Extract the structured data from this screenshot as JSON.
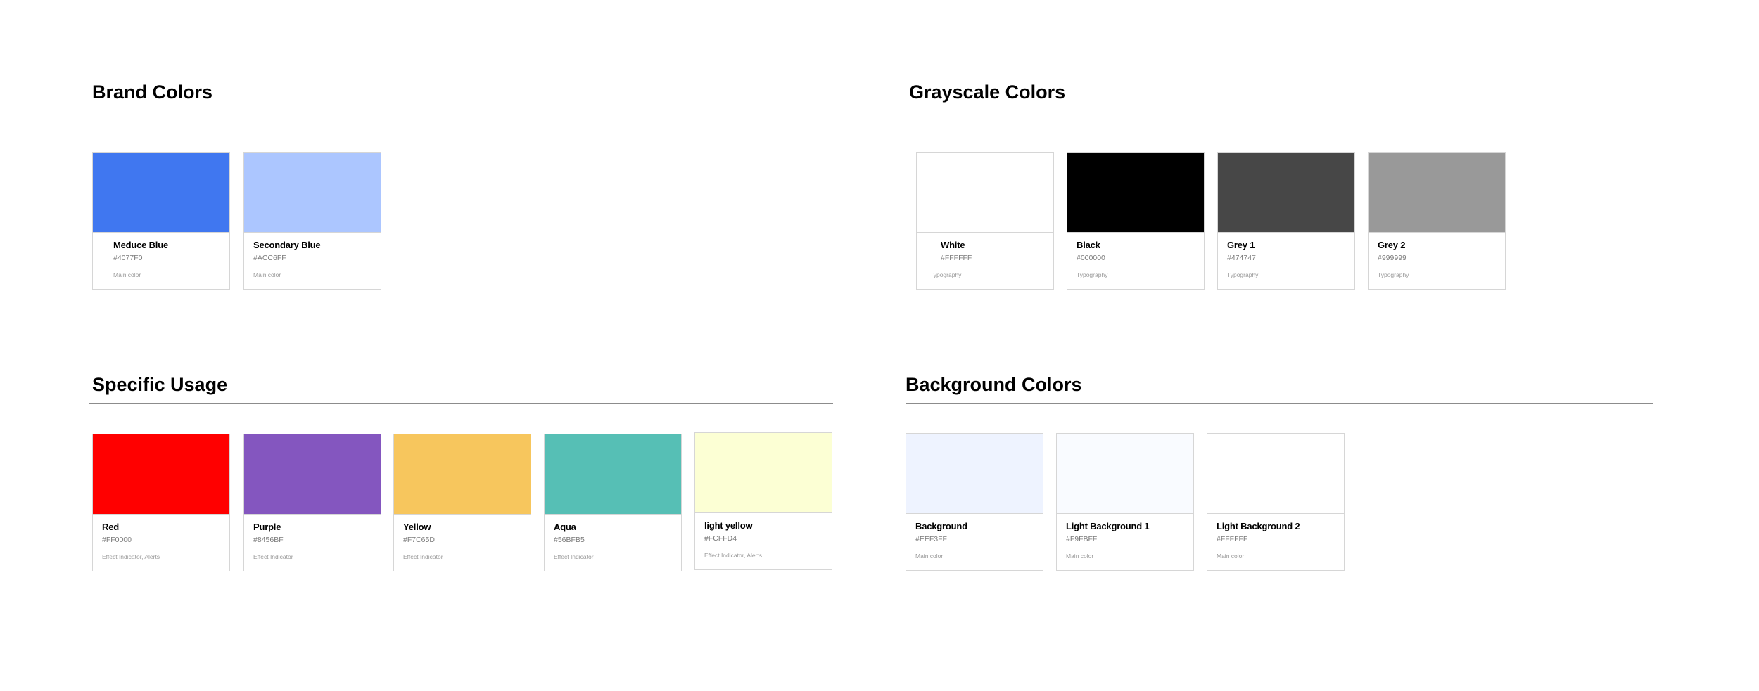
{
  "sections": [
    {
      "title": "Brand Colors",
      "swatches": [
        {
          "name": "Meduce Blue",
          "hex": "#4077F0",
          "usage": "Main color",
          "color": "#4077F0"
        },
        {
          "name": "Secondary Blue",
          "hex": "#ACC6FF",
          "usage": "Main color",
          "color": "#ACC6FF"
        }
      ]
    },
    {
      "title": "Grayscale Colors",
      "swatches": [
        {
          "name": "White",
          "hex": "#FFFFFF",
          "usage": "Typography",
          "color": "#FFFFFF"
        },
        {
          "name": "Black",
          "hex": "#000000",
          "usage": "Typography",
          "color": "#000000"
        },
        {
          "name": "Grey 1",
          "hex": "#474747",
          "usage": "Typography",
          "color": "#474747"
        },
        {
          "name": "Grey 2",
          "hex": "#999999",
          "usage": "Typography",
          "color": "#999999"
        }
      ]
    },
    {
      "title": "Specific Usage",
      "swatches": [
        {
          "name": "Red",
          "hex": "#FF0000",
          "usage": "Effect Indicator, Alerts",
          "color": "#FF0000"
        },
        {
          "name": "Purple",
          "hex": "#8456BF",
          "usage": "Effect Indicator",
          "color": "#8456BF"
        },
        {
          "name": "Yellow",
          "hex": "#F7C65D",
          "usage": "Effect Indicator",
          "color": "#F7C65D"
        },
        {
          "name": "Aqua",
          "hex": "#56BFB5",
          "usage": "Effect Indicator",
          "color": "#56BFB5"
        },
        {
          "name": "light yellow",
          "hex": "#FCFFD4",
          "usage": "Effect Indicator, Alerts",
          "color": "#FCFFD4"
        }
      ]
    },
    {
      "title": "Background Colors",
      "swatches": [
        {
          "name": "Background",
          "hex": "#EEF3FF",
          "usage": "Main color",
          "color": "#EEF3FF"
        },
        {
          "name": "Light Background 1",
          "hex": "#F9FBFF",
          "usage": "Main color",
          "color": "#F9FBFF"
        },
        {
          "name": "Light Background 2",
          "hex": "#FFFFFF",
          "usage": "Main color",
          "color": "#FFFFFF"
        }
      ]
    }
  ]
}
